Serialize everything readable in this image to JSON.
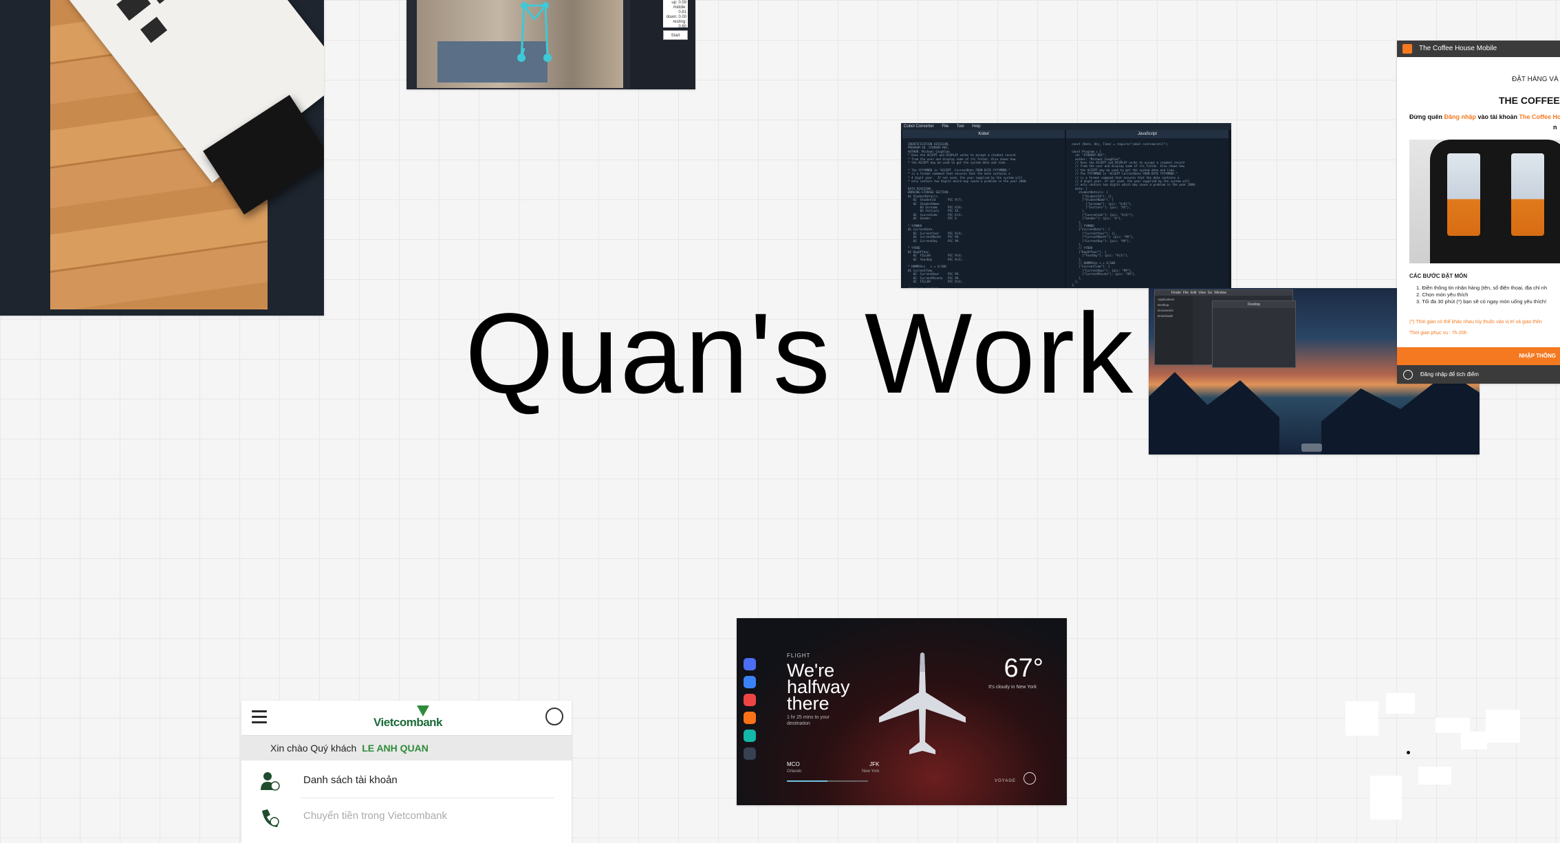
{
  "page": {
    "title": "Quan's Work"
  },
  "pose_card": {
    "stats": [
      "up: 0.59",
      "middle: 0.81",
      "down: 0.00",
      "resting: 0.60"
    ],
    "start_label": "Start"
  },
  "cobol_card": {
    "app_name": "Cobol Converter",
    "menu": [
      "File",
      "Tool",
      "Help"
    ],
    "left_pane_title": "Kobol",
    "right_pane_title": "JavaScript"
  },
  "desktop_card": {
    "finder_title": "Desktop",
    "menu": [
      "Finder",
      "File",
      "Edit",
      "View",
      "Go",
      "Window"
    ],
    "sidebar": [
      "Applications",
      "Desktop",
      "Documents",
      "Downloads"
    ]
  },
  "coffee_card": {
    "window_title": "The Coffee House Mobile",
    "heading_small": "ĐẶT HÀNG VÀ C",
    "heading_big": "THE COFFEE H",
    "reminder_prefix": "Đừng quên ",
    "reminder_login": "Đăng nhập",
    "reminder_mid": " vào tài khoản ",
    "reminder_brand": "The Coffee Ho",
    "reminder_tail": "n",
    "steps_title": "CÁC BƯỚC ĐẶT MÓN",
    "steps": [
      "1. Điền thông tin nhận hàng (tên, số điện thoại, địa chỉ nh",
      "2. Chọn món yêu thích",
      "3. Tối đa 30 phút (*) bạn sẽ có ngay món uống yêu thích!"
    ],
    "note": "(*) Thời gian có thể khác nhau tùy thuộc vào vị trí và giao thôn",
    "hours": "Thời gian phục vụ : 7h-20h",
    "order_button": "NHẬP THÔNG",
    "login_prompt": "Đăng nhập để tích điểm"
  },
  "vcb_card": {
    "brand": "Vietcombank",
    "greeting": "Xin chào Quý khách",
    "customer_name": "LE ANH QUAN",
    "menu": [
      {
        "label": "Danh sách tài khoản",
        "icon": "account-list-icon",
        "enabled": true
      },
      {
        "label": "Chuyển tiền trong Vietcombank",
        "icon": "transfer-icon",
        "enabled": false
      }
    ]
  },
  "flight_card": {
    "label": "FLIGHT",
    "headline": "We're halfway there",
    "sub": "1 hr 25 mins to your destination",
    "temperature": "67°",
    "condition": "It's cloudy in New York",
    "from_code": "MCO",
    "from_city": "Orlando",
    "to_code": "JFK",
    "to_city": "New York",
    "progress": 0.5,
    "voyage_label": "VOYAGE",
    "app_icons": [
      {
        "name": "home-icon",
        "color": "#4c6ef5"
      },
      {
        "name": "music-icon",
        "color": "#3b82f6"
      },
      {
        "name": "play-icon",
        "color": "#ef4444"
      },
      {
        "name": "game-icon",
        "color": "#f97316"
      },
      {
        "name": "message-icon",
        "color": "#14b8a6"
      },
      {
        "name": "grid-icon",
        "color": "#374151"
      }
    ]
  }
}
